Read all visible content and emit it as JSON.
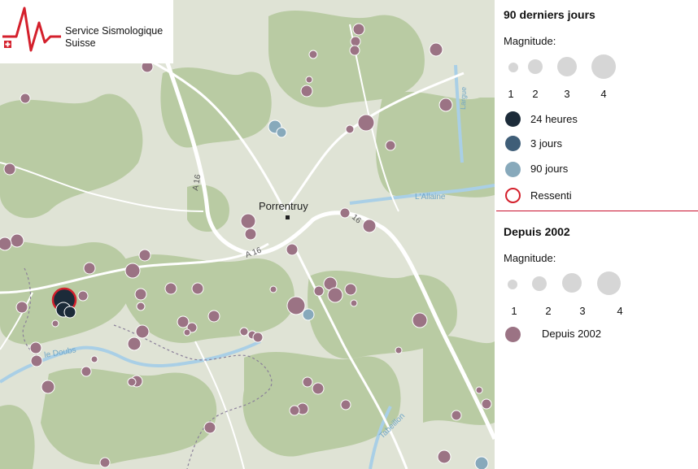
{
  "logo": {
    "line1": "Service Sismologique",
    "line2": "Suisse"
  },
  "map_labels": {
    "town": "Porrentruy",
    "road_a16_1": "A 16",
    "road_a16_2": "A 16",
    "road_16": "16",
    "river_doubs": "le Doubs",
    "river_allaine": "L'Allaine",
    "river_tabeillon": "Tabeillon",
    "river_larg": "Largue"
  },
  "legend_recent": {
    "title": "90 derniers jours",
    "magnitude_label": "Magnitude:",
    "mag_values": [
      "1",
      "2",
      "3",
      "4"
    ],
    "items": [
      {
        "label": "24 heures",
        "color": "#1c2b39"
      },
      {
        "label": "3 jours",
        "color": "#3f5e78"
      },
      {
        "label": "90 jours",
        "color": "#87a9bb"
      },
      {
        "label": "Ressenti",
        "color": "#d4202c"
      }
    ]
  },
  "legend_since": {
    "title": "Depuis 2002",
    "magnitude_label": "Magnitude:",
    "mag_values": [
      "1",
      "2",
      "3",
      "4"
    ],
    "item": {
      "label": "Depuis 2002",
      "color": "#9b7384"
    }
  },
  "colors": {
    "historic": "#9b7384",
    "recent_24h": "#1c2b39",
    "recent_3d": "#3f5e78",
    "recent_90d": "#87a9bb",
    "felt": "#d4202c",
    "forest": "#b7c9a0",
    "open_land": "#dfe3d5",
    "road": "#ffffff",
    "river": "#a9cfe6"
  }
}
